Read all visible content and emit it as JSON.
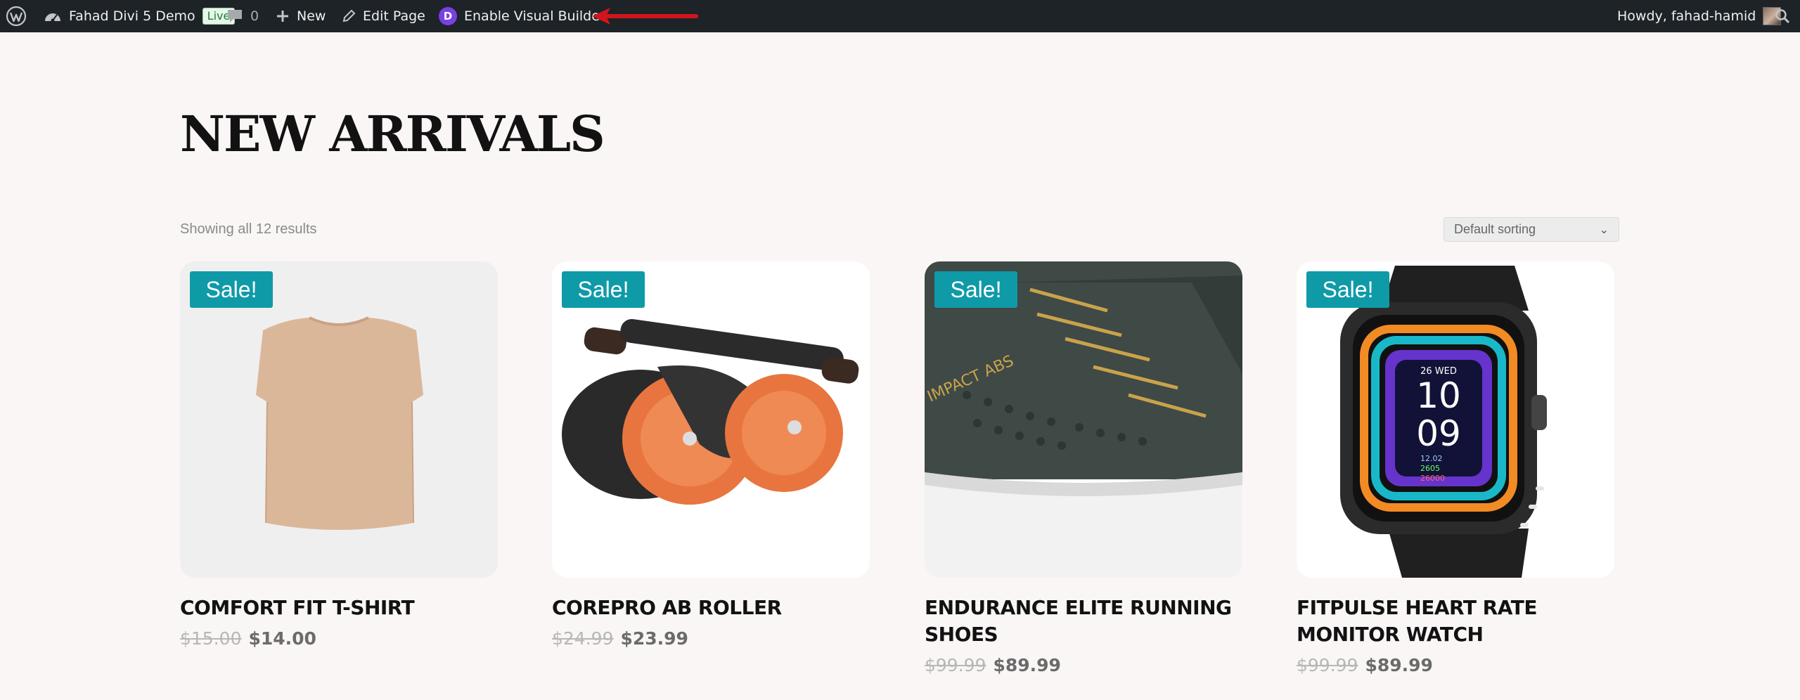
{
  "adminbar": {
    "site_name": "Fahad Divi 5 Demo",
    "live_badge": "Live",
    "comment_count": "0",
    "new_label": "New",
    "edit_page_label": "Edit Page",
    "divi_letter": "D",
    "visual_builder_label": "Enable Visual Builder",
    "greeting": "Howdy, fahad-hamid"
  },
  "page": {
    "title": "NEW ARRIVALS",
    "result_count": "Showing all 12 results",
    "sort_selected": "Default sorting"
  },
  "colors": {
    "adminbar_bg": "#1d2327",
    "sale_badge": "#0f9aa8",
    "page_bg": "#f9f6f5",
    "annotation_arrow": "#d0161c"
  },
  "products": [
    {
      "sale_label": "Sale!",
      "name": "COMFORT FIT T-SHIRT",
      "old_price": "$15.00",
      "price": "$14.00",
      "image": "beige-sleeveless-tshirt"
    },
    {
      "sale_label": "Sale!",
      "name": "COREPRO AB ROLLER",
      "old_price": "$24.99",
      "price": "$23.99",
      "image": "orange-black-ab-roller"
    },
    {
      "sale_label": "Sale!",
      "name": "ENDURANCE ELITE RUNNING SHOES",
      "old_price": "$99.99",
      "price": "$89.99",
      "image": "dark-green-running-shoe",
      "shoe_print": "IMPACT ABS"
    },
    {
      "sale_label": "Sale!",
      "name": "FITPULSE HEART RATE MONITOR WATCH",
      "old_price": "$99.99",
      "price": "$89.99",
      "image": "black-smartwatch",
      "watch": {
        "date": "26 WED",
        "hour": "10",
        "minute": "09",
        "stat1": "12.02",
        "stat2": "2605",
        "stat3": "26000"
      }
    }
  ]
}
